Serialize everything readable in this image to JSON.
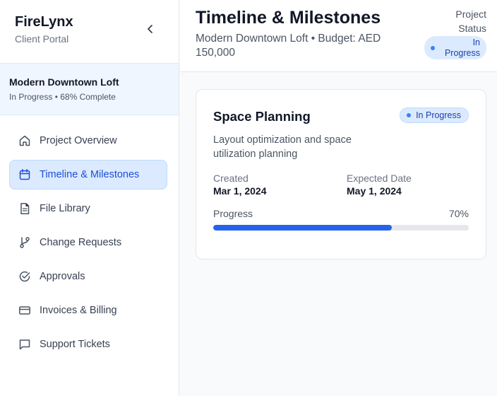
{
  "brand": {
    "name": "FireLynx",
    "subtitle": "Client Portal"
  },
  "project": {
    "name": "Modern Downtown Loft",
    "meta": "In Progress • 68% Complete"
  },
  "nav": [
    {
      "label": "Project Overview",
      "icon": "home-icon",
      "active": false
    },
    {
      "label": "Timeline & Milestones",
      "icon": "calendar-icon",
      "active": true
    },
    {
      "label": "File Library",
      "icon": "file-icon",
      "active": false
    },
    {
      "label": "Change Requests",
      "icon": "git-branch-icon",
      "active": false
    },
    {
      "label": "Approvals",
      "icon": "check-circle-icon",
      "active": false
    },
    {
      "label": "Invoices & Billing",
      "icon": "credit-card-icon",
      "active": false
    },
    {
      "label": "Support Tickets",
      "icon": "message-icon",
      "active": false
    }
  ],
  "header": {
    "title": "Timeline & Milestones",
    "subtitle": "Modern Downtown Loft • Budget: AED 150,000",
    "status_label": "Project Status",
    "status_value": "In Progress"
  },
  "milestone": {
    "title": "Space Planning",
    "status": "In Progress",
    "description": "Layout optimization and space utilization planning",
    "created_label": "Created",
    "created_value": "Mar 1, 2024",
    "expected_label": "Expected Date",
    "expected_value": "May 1, 2024",
    "progress_label": "Progress",
    "progress_text": "70%",
    "progress": 0.7
  },
  "colors": {
    "accent": "#2563eb",
    "accent_light": "#dbeafe",
    "accent_text": "#1d4ed8"
  }
}
